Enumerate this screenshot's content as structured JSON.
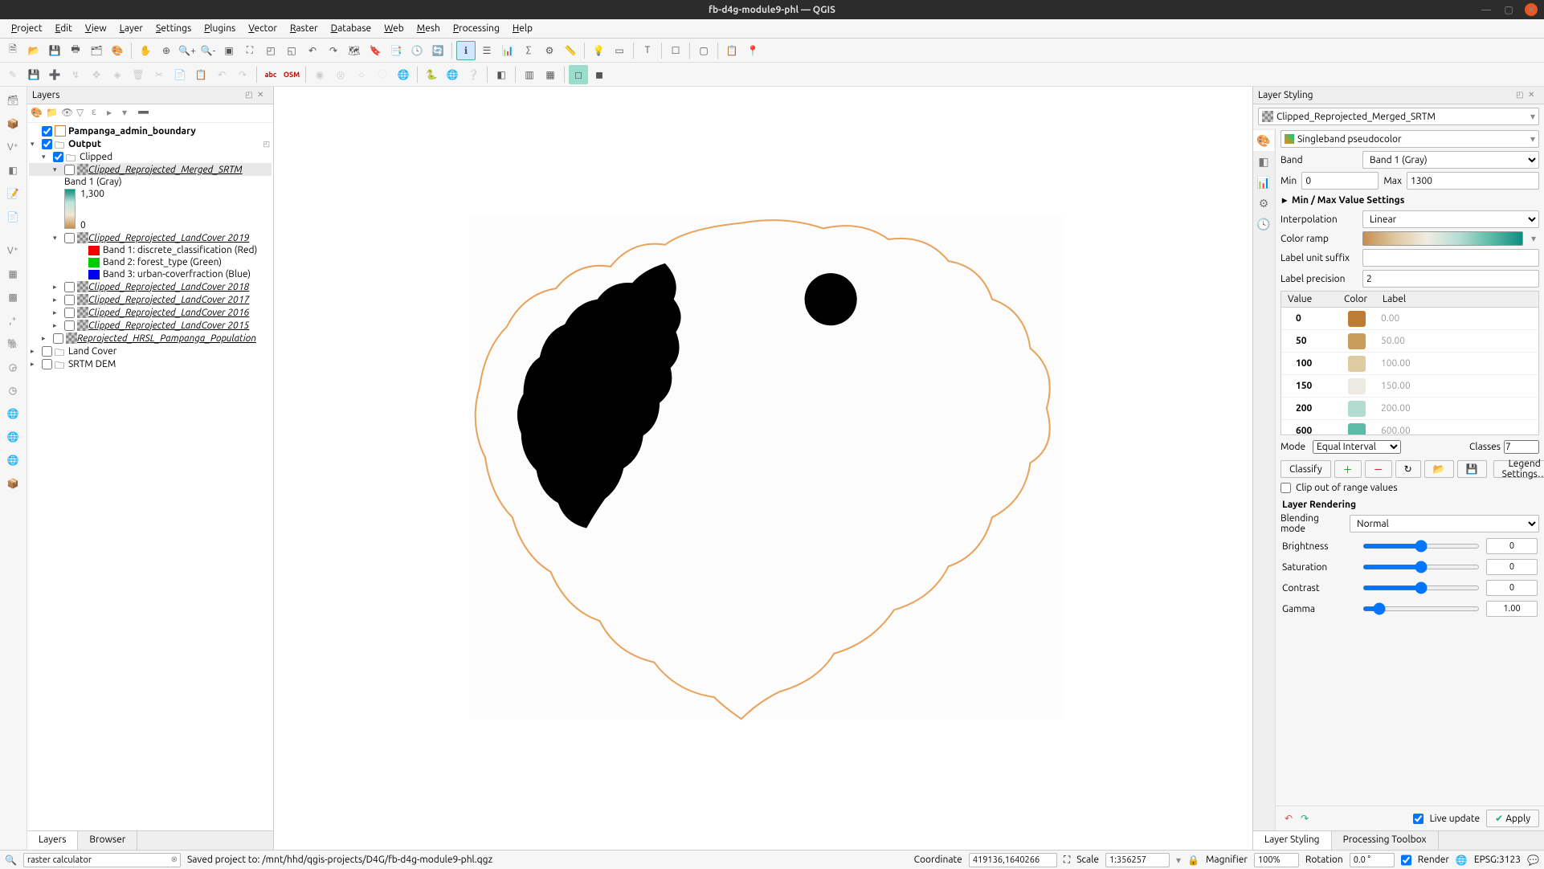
{
  "window": {
    "title": "fb-d4g-module9-phl — QGIS"
  },
  "menubar": [
    "Project",
    "Edit",
    "View",
    "Layer",
    "Settings",
    "Plugins",
    "Vector",
    "Raster",
    "Database",
    "Web",
    "Mesh",
    "Processing",
    "Help"
  ],
  "layers_panel": {
    "title": "Layers",
    "tree": {
      "l0": "Pampanga_admin_boundary",
      "l1": "Output",
      "l2": "Clipped",
      "l3": "Clipped_Reprojected_Merged_SRTM",
      "l3a": "Band 1 (Gray)",
      "l3b": "1,300",
      "l3c": "0",
      "l4": "Clipped_Reprojected_LandCover 2019",
      "l4a": "Band 1: discrete_classification (Red)",
      "l4b": "Band 2: forest_type (Green)",
      "l4c": "Band 3: urban-coverfraction (Blue)",
      "l5": "Clipped_Reprojected_LandCover 2018",
      "l6": "Clipped_Reprojected_LandCover 2017",
      "l7": "Clipped_Reprojected_LandCover 2016",
      "l8": "Clipped_Reprojected_LandCover 2015",
      "l9": "Reprojected_HRSL_Pampanga_Population",
      "l10": "Land Cover",
      "l11": "SRTM DEM"
    },
    "tabs": {
      "layers": "Layers",
      "browser": "Browser"
    }
  },
  "styling": {
    "title": "Layer Styling",
    "layer": "Clipped_Reprojected_Merged_SRTM",
    "render_type": "Singleband pseudocolor",
    "band_label": "Band",
    "band_value": "Band 1 (Gray)",
    "min_label": "Min",
    "min_value": "0",
    "max_label": "Max",
    "max_value": "1300",
    "minmax_settings": "Min / Max Value Settings",
    "interp_label": "Interpolation",
    "interp_value": "Linear",
    "ramp_label": "Color ramp",
    "suffix_label": "Label unit suffix",
    "suffix_value": "",
    "precision_label": "Label precision",
    "precision_value": "2",
    "table_headers": {
      "value": "Value",
      "color": "Color",
      "label": "Label"
    },
    "table": [
      {
        "v": "0",
        "c": "#bd7b33",
        "l": "0.00"
      },
      {
        "v": "50",
        "c": "#c99d5c",
        "l": "50.00"
      },
      {
        "v": "100",
        "c": "#dfcba2",
        "l": "100.00"
      },
      {
        "v": "150",
        "c": "#eceae2",
        "l": "150.00"
      },
      {
        "v": "200",
        "c": "#b3dcd0",
        "l": "200.00"
      },
      {
        "v": "600",
        "c": "#5abca6",
        "l": "600.00"
      }
    ],
    "mode_label": "Mode",
    "mode_value": "Equal Interval",
    "classes_label": "Classes",
    "classes_value": "7",
    "classify": "Classify",
    "legend_settings": "Legend Settings…",
    "clip_ooo": "Clip out of range values",
    "rendering_hdr": "Layer Rendering",
    "blend_label": "Blending mode",
    "blend_value": "Normal",
    "brightness_label": "Brightness",
    "brightness_value": "0",
    "saturation_label": "Saturation",
    "saturation_value": "0",
    "contrast_label": "Contrast",
    "contrast_value": "0",
    "gamma_label": "Gamma",
    "gamma_value": "1.00",
    "live_update": "Live update",
    "apply": "Apply",
    "tabs": {
      "styling": "Layer Styling",
      "toolbox": "Processing Toolbox"
    }
  },
  "statusbar": {
    "locator_value": "raster calculator",
    "message": "Saved project to: /mnt/hhd/qgis-projects/D4G/fb-d4g-module9-phl.qgz",
    "coord_label": "Coordinate",
    "coord_value": "419136,1640266",
    "scale_label": "Scale",
    "scale_value": "1:356257",
    "magnifier_label": "Magnifier",
    "magnifier_value": "100%",
    "rotation_label": "Rotation",
    "rotation_value": "0.0 °",
    "render_label": "Render",
    "crs": "EPSG:3123"
  }
}
